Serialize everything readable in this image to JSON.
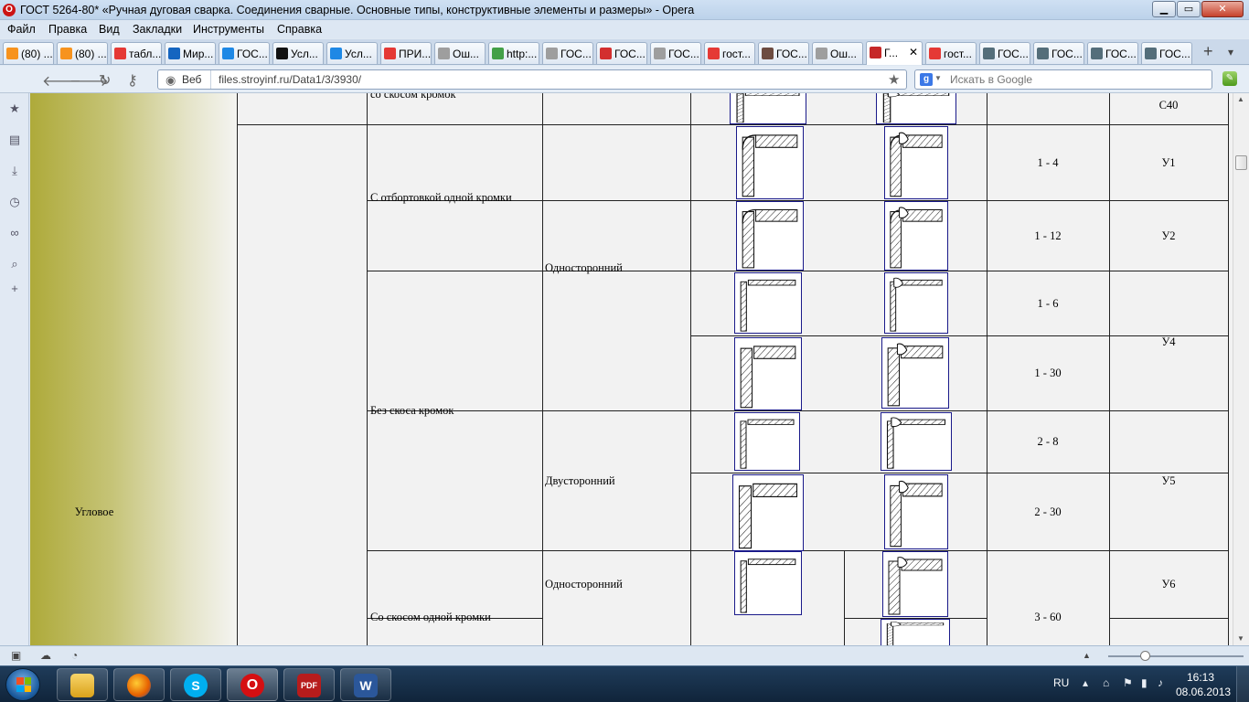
{
  "window": {
    "title": "ГОСТ 5264-80* «Ручная дуговая сварка. Соединения сварные. Основные типы, конструктивные элементы и размеры» - Opera",
    "icon_letter": "O",
    "min_label": "▁",
    "max_label": "▭",
    "close_label": "✕"
  },
  "menu": [
    "Файл",
    "Правка",
    "Вид",
    "Закладки",
    "Инструменты",
    "Справка"
  ],
  "tabs": [
    {
      "label": "(80) ...",
      "icon": "ok-icon",
      "color": "#f7931e"
    },
    {
      "label": "(80) ...",
      "icon": "ok-icon",
      "color": "#f7931e"
    },
    {
      "label": "табл...",
      "icon": "yandex-icon",
      "color": "#e53935"
    },
    {
      "label": "Мир...",
      "icon": "mail-icon",
      "color": "#1565c0"
    },
    {
      "label": "ГОС...",
      "icon": "info-icon",
      "color": "#1e88e5"
    },
    {
      "label": "Усл...",
      "icon": "diamond-icon",
      "color": "#111111"
    },
    {
      "label": "Усл...",
      "icon": "shield-icon",
      "color": "#1e88e5"
    },
    {
      "label": "ПРИ...",
      "icon": "yandex-icon",
      "color": "#e53935"
    },
    {
      "label": "Ош...",
      "icon": "page-icon",
      "color": "#9e9e9e"
    },
    {
      "label": "http:...",
      "icon": "gear-icon",
      "color": "#43a047"
    },
    {
      "label": "ГОС...",
      "icon": "page-icon",
      "color": "#9e9e9e"
    },
    {
      "label": "ГОС...",
      "icon": "mountain-icon",
      "color": "#d32f2f"
    },
    {
      "label": "ГОС...",
      "icon": "page-icon",
      "color": "#9e9e9e"
    },
    {
      "label": "гост...",
      "icon": "yandex-icon",
      "color": "#e53935"
    },
    {
      "label": "ГОС...",
      "icon": "pen-icon",
      "color": "#6d4c41"
    },
    {
      "label": "Ош...",
      "icon": "page-icon",
      "color": "#9e9e9e"
    },
    {
      "label": "Г...",
      "icon": "opera-red-icon",
      "color": "#c62828",
      "active": true
    },
    {
      "label": "гост...",
      "icon": "yandex-icon",
      "color": "#e53935"
    },
    {
      "label": "ГОС...",
      "icon": "globe-icon",
      "color": "#546e7a"
    },
    {
      "label": "ГОС...",
      "icon": "search-page-icon",
      "color": "#546e7a"
    },
    {
      "label": "ГОС...",
      "icon": "globe-icon",
      "color": "#546e7a"
    },
    {
      "label": "ГОС...",
      "icon": "search-page-icon",
      "color": "#546e7a"
    }
  ],
  "address": {
    "web_label": "Веб",
    "url": "files.stroyinf.ru/Data1/3/3930/",
    "search_placeholder": "Искать в Google",
    "search_engine": "g"
  },
  "table": {
    "row_type": "Угловое",
    "c40_code": "С40",
    "groups": [
      {
        "edge": "С отбортовкой одной кромки"
      },
      {
        "edge": "Без скоса кромок"
      },
      {
        "edge": "Со скосом одной кромки"
      }
    ],
    "seam": {
      "one_sided_1": "Односторонний",
      "two_sided": "Двусторонний",
      "one_sided_2": "Односторонний"
    },
    "thickness": [
      "1 - 4",
      "1 - 12",
      "1 - 6",
      "1 - 30",
      "2 - 8",
      "2 - 30",
      "3 - 60"
    ],
    "codes": [
      "У1",
      "У2",
      "У4",
      "У5",
      "У6"
    ],
    "partial_text": "со скосом кромок"
  },
  "status": {
    "lang": "RU",
    "time": "16:13",
    "date": "08.06.2013"
  },
  "colors": {
    "opera_red": "#cc1414",
    "drawing_border": "#1a1a8a",
    "side_gradient": "#aeaa3a"
  }
}
